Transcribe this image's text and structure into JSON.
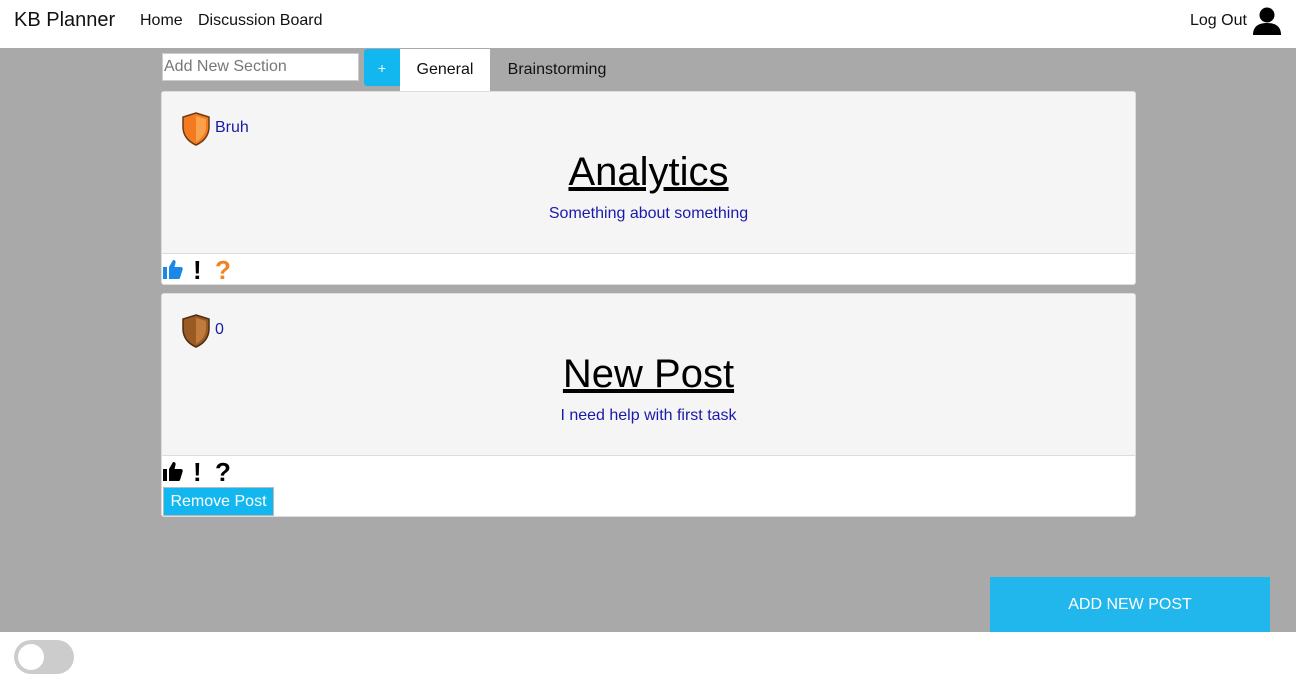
{
  "navbar": {
    "brand": "KB Planner",
    "links": [
      "Home",
      "Discussion Board"
    ],
    "logout": "Log Out"
  },
  "toolbar": {
    "section_placeholder": "Add New Section",
    "add_section_label": "+",
    "tabs": [
      {
        "label": "General",
        "active": true
      },
      {
        "label": "Brainstorming",
        "active": false
      }
    ]
  },
  "posts": [
    {
      "author": "Bruh",
      "badge": "orange-shield-icon",
      "title": "Analytics",
      "description": "Something about something",
      "reaction_colors": {
        "like": "#1b87e6",
        "exclaim": "#000000",
        "question": "#f58220"
      }
    },
    {
      "author": "0",
      "badge": "bronze-shield-icon",
      "title": "New Post",
      "description": "I need help with first task",
      "reaction_colors": {
        "like": "#000000",
        "exclaim": "#000000",
        "question": "#000000"
      },
      "remove_label": "Remove Post"
    }
  ],
  "add_post_label": "ADD NEW POST",
  "colors": {
    "accent": "#12b7ef",
    "background": "#a9a9a9",
    "link_text": "#1a1aaa"
  }
}
